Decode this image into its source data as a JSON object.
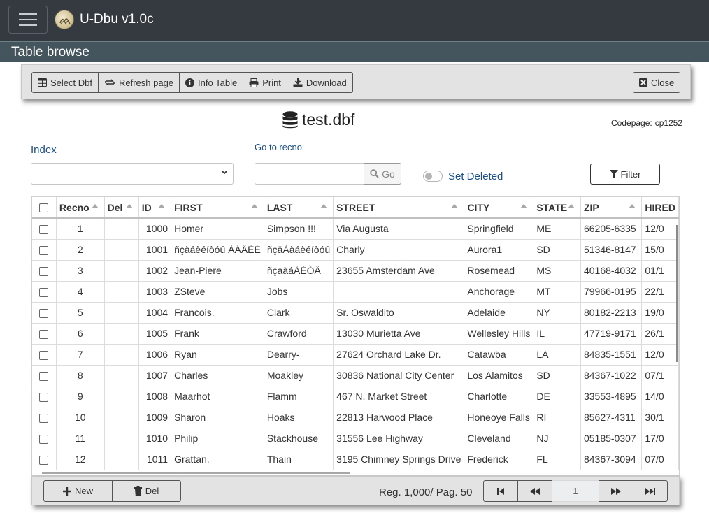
{
  "app": {
    "title": "U-Dbu v1.0c"
  },
  "page": {
    "title": "Table browse"
  },
  "toolbar": {
    "select_dbf": "Select Dbf",
    "refresh_page": "Refresh page",
    "info_table": "Info Table",
    "print": "Print",
    "download": "Download",
    "close": "Close"
  },
  "file": {
    "name": "test.dbf",
    "codepage_label": "Codepage:",
    "codepage_value": "cp1252"
  },
  "index": {
    "label": "Index",
    "selected": ""
  },
  "goto": {
    "label": "Go to recno",
    "value": "",
    "button": "Go"
  },
  "set_deleted": {
    "label": "Set Deleted",
    "checked": false
  },
  "filter": {
    "label": "Filter"
  },
  "table": {
    "columns": [
      "Recno",
      "Del",
      "ID",
      "FIRST",
      "LAST",
      "STREET",
      "CITY",
      "STATE",
      "ZIP",
      "HIRED"
    ],
    "rows": [
      [
        "1",
        "",
        "1000",
        "Homer",
        "Simpson !!!",
        "Via Augusta",
        "Springfield",
        "ME",
        "66205-6335",
        "12/0"
      ],
      [
        "2",
        "",
        "1001",
        "ñçàáèéíòóú ÀÁÄÈÉ",
        "ñçäÀàáèéíòóú",
        "Charly",
        "Aurora1",
        "SD",
        "51346-8147",
        "15/0"
      ],
      [
        "3",
        "",
        "1002",
        "Jean-Piere",
        "ñçaàáÀÈÒÄ",
        "23655 Amsterdam Ave",
        "Rosemead",
        "MS",
        "40168-4032",
        "01/1"
      ],
      [
        "4",
        "",
        "1003",
        "ZSteve",
        "Jobs",
        "",
        "Anchorage",
        "MT",
        "79966-0195",
        "22/1"
      ],
      [
        "5",
        "",
        "1004",
        "Francois.",
        "Clark",
        "Sr. Oswaldito",
        "Adelaide",
        "NY",
        "80182-2213",
        "19/0"
      ],
      [
        "6",
        "",
        "1005",
        "Frank",
        "Crawford",
        "13030 Murietta Ave",
        "Wellesley Hills",
        "IL",
        "47719-9171",
        "26/1"
      ],
      [
        "7",
        "",
        "1006",
        "Ryan",
        "Dearry-",
        "27624 Orchard Lake Dr.",
        "Catawba",
        "LA",
        "84835-1551",
        "12/0"
      ],
      [
        "8",
        "",
        "1007",
        "Charles",
        "Moakley",
        "30836 National City Center",
        "Los Alamitos",
        "SD",
        "84367-1022",
        "07/1"
      ],
      [
        "9",
        "",
        "1008",
        "Maarhot",
        "Flamm",
        "467 N. Market Street",
        "Charlotte",
        "DE",
        "33553-4895",
        "14/0"
      ],
      [
        "10",
        "",
        "1009",
        "Sharon",
        "Hoaks",
        "22813 Harwood Place",
        "Honeoye Falls",
        "RI",
        "85627-4311",
        "30/1"
      ],
      [
        "11",
        "",
        "1010",
        "Philip",
        "Stackhouse",
        "31556 Lee Highway",
        "Cleveland",
        "NJ",
        "05185-0307",
        "17/0"
      ],
      [
        "12",
        "",
        "1011",
        "Grattan.",
        "Thain",
        "3195 Chimney Springs Drive",
        "Frederick",
        "FL",
        "84367-3094",
        "07/0"
      ]
    ]
  },
  "footer": {
    "new": "New",
    "del": "Del",
    "reg_info": "Reg. 1,000/ Pag. 50",
    "page_value": "1"
  },
  "icons": {
    "menu": "hamburger-icon",
    "logo": "logo-icon",
    "table": "table-icon",
    "refresh": "refresh-icon",
    "info": "info-icon",
    "print": "print-icon",
    "download": "download-icon",
    "close": "close-icon",
    "database": "database-icon",
    "search": "search-icon",
    "filter": "filter-icon",
    "plus": "plus-icon",
    "trash": "trash-icon"
  },
  "colors": {
    "navbar": "#343a40",
    "header": "#44555e",
    "link": "#1a4f8b",
    "panel": "#e3e3e3"
  }
}
